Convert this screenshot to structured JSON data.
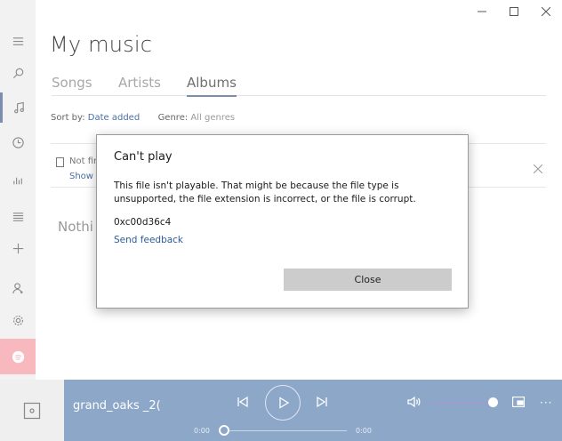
{
  "window": {
    "controls": [
      "minimize",
      "maximize",
      "close"
    ]
  },
  "nav": {
    "items": [
      {
        "name": "hamburger-icon"
      },
      {
        "name": "search-icon"
      },
      {
        "name": "music-note-icon"
      },
      {
        "name": "clock-icon"
      },
      {
        "name": "chart-icon"
      },
      {
        "name": "queue-icon"
      },
      {
        "name": "add-icon"
      },
      {
        "name": "user-icon"
      },
      {
        "name": "gear-icon"
      },
      {
        "name": "spotify-icon"
      }
    ],
    "accent": "#7a8fb0",
    "spotify_color": "#f7b9bd"
  },
  "header": {
    "title": "My music"
  },
  "tabs": [
    {
      "label": "Songs",
      "active": false
    },
    {
      "label": "Artists",
      "active": false
    },
    {
      "label": "Albums",
      "active": true
    }
  ],
  "sort": {
    "label": "Sort by:",
    "value": "Date added",
    "genre_label": "Genre:",
    "genre_value": "All genres"
  },
  "notice": {
    "line1": "Not fin",
    "line2": "Show"
  },
  "empty_text": "Nothi",
  "dialog": {
    "title": "Can't play",
    "message": "This file isn't playable. That might be because the file type is unsupported, the file extension is incorrect, or the file is corrupt.",
    "code": "0xc00d36c4",
    "feedback": "Send feedback",
    "close_label": "Close"
  },
  "player": {
    "track": "grand_oaks    _2(",
    "time_start": "0:00",
    "time_end": "0:00",
    "progress": 0,
    "more": "···",
    "bar_color": "#8da7c8"
  }
}
